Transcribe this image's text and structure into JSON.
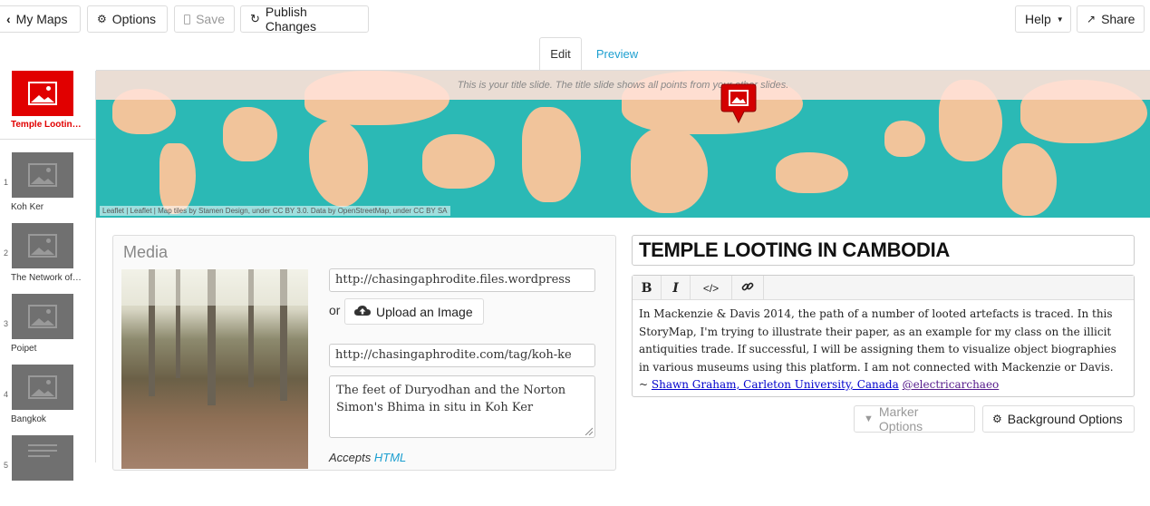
{
  "toolbar": {
    "my_maps": "My Maps",
    "options": "Options",
    "save": "Save",
    "publish": "Publish Changes",
    "help": "Help",
    "share": "Share"
  },
  "tabs": {
    "edit": "Edit",
    "preview": "Preview"
  },
  "sidebar": {
    "title_slide": "Temple Looting in Cambodia",
    "slides": [
      {
        "num": "1",
        "label": "Koh Ker"
      },
      {
        "num": "2",
        "label": "The Network of Trafficking"
      },
      {
        "num": "3",
        "label": "Poipet"
      },
      {
        "num": "4",
        "label": "Bangkok"
      },
      {
        "num": "5",
        "label": ""
      }
    ]
  },
  "map": {
    "caption": "This is your title slide. The title slide shows all points from your other slides.",
    "attribution": "Leaflet | Leaflet | Map tiles by Stamen Design, under CC BY 3.0. Data by OpenStreetMap, under CC BY SA"
  },
  "media": {
    "heading": "Media",
    "url": "http://chasingaphrodite.files.wordpress",
    "or": "or",
    "upload": "Upload an Image",
    "credit_url": "http://chasingaphrodite.com/tag/koh-ke",
    "caption": "The feet of Duryodhan and the Norton Simon's Bhima in situ in Koh Ker",
    "accepts": "Accepts",
    "accepts_link": "HTML"
  },
  "slide": {
    "title": "TEMPLE LOOTING IN CAMBODIA",
    "bold": "B",
    "italic": "I",
    "code": "</>",
    "body": "In Mackenzie & Davis 2014, the path of a number of looted artefacts is traced. In this StoryMap, I'm trying to illustrate their paper, as an example for my class on the illicit antiquities trade. If successful, I will be assigning them to visualize object biographies in various museums using this platform.  I am not connected with Mackenzie or Davis.",
    "sig_prefix": "~ ",
    "sig_link": "Shawn Graham, Carleton University, Canada",
    "twitter": "@electricarchaeo"
  },
  "buttons": {
    "marker": "Marker Options",
    "background": "Background Options"
  },
  "colors": {
    "accent": "#1c9fd0",
    "marker": "#e10000",
    "sea": "#2bb9b5",
    "land": "#f1c49b"
  }
}
